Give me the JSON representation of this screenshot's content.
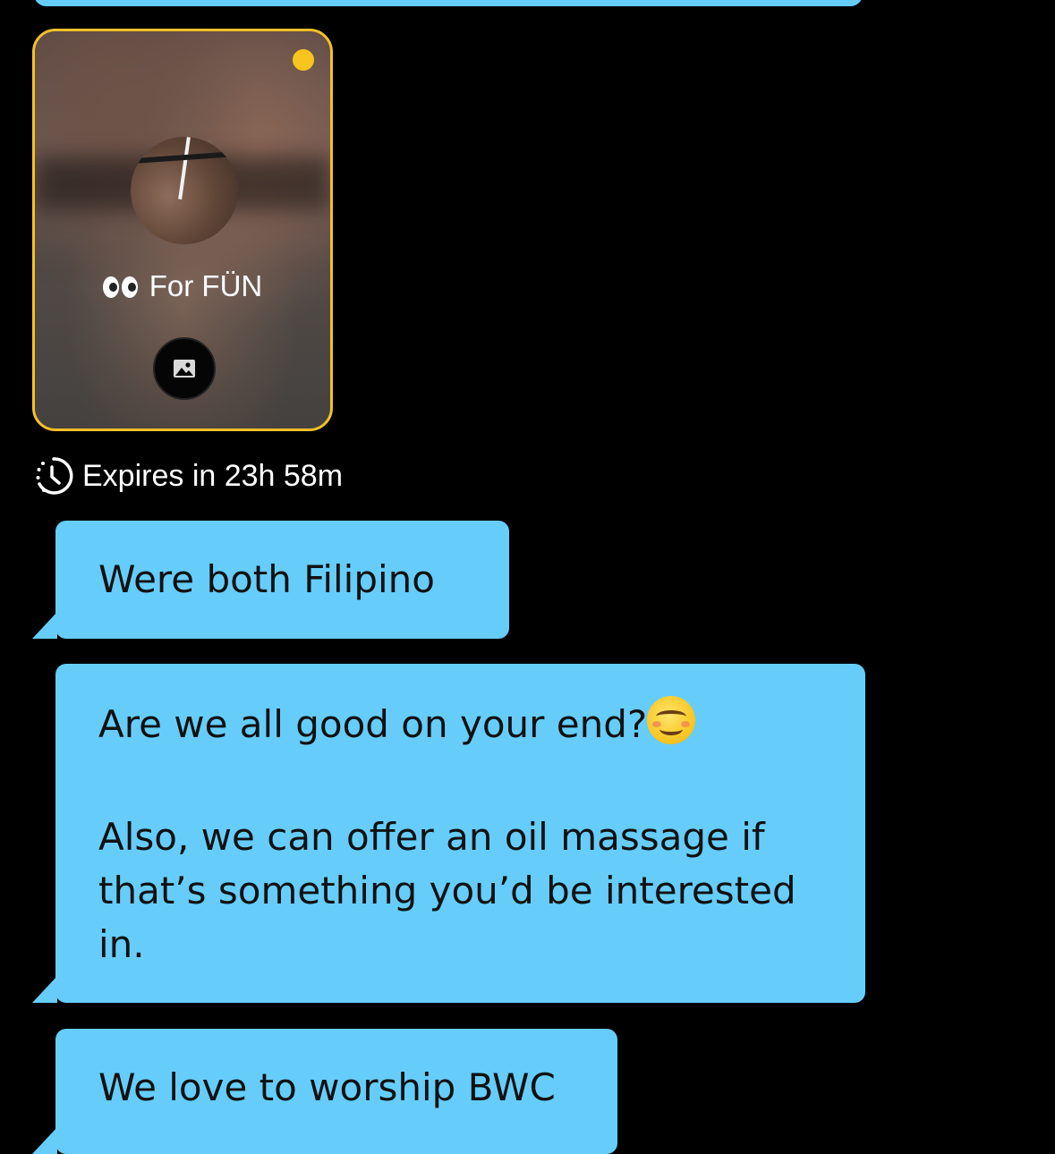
{
  "album": {
    "label": "For FÜN",
    "eyes_icon": "eyes-emoji-icon",
    "accent_color": "#f5c027",
    "new_indicator_color": "#f7c51e",
    "photo_icon": "photo-icon"
  },
  "expiry": {
    "icon": "timer-icon",
    "text": "Expires in 23h 58m"
  },
  "messages": [
    {
      "text": "Were both Filipino"
    },
    {
      "line1": "Are we all good on your end?",
      "emoji": "smiling-face-icon",
      "line2": "Also, we can offer an oil massage if",
      "line3": "that’s something you’d be interested",
      "line4": "in."
    },
    {
      "text": "We love to worship BWC"
    }
  ],
  "bubble_color": "#66cdfa"
}
